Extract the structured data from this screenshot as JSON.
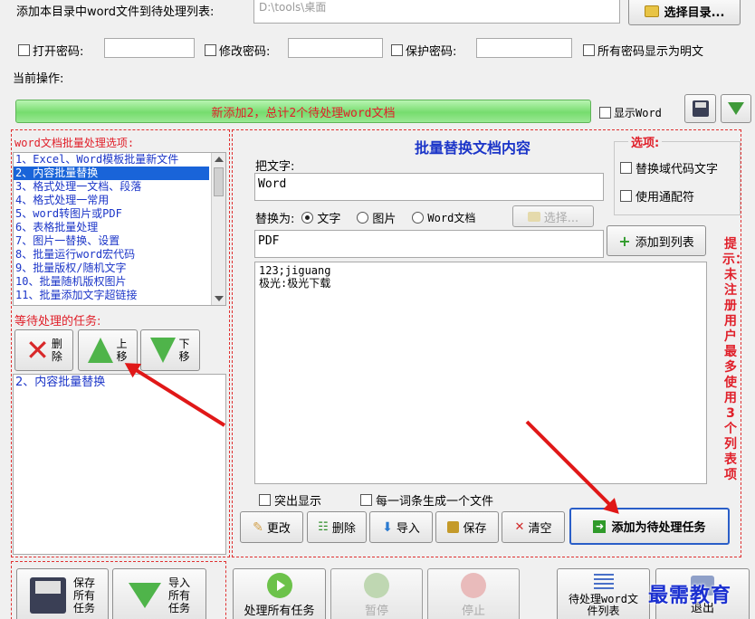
{
  "top": {
    "add_dir_label": "添加本目录中word文件到待处理列表:",
    "dir_path": "D:\\tools\\桌面",
    "choose_dir_label": "选择目录..."
  },
  "passwords": {
    "open_label": "打开密码:",
    "modify_label": "修改密码:",
    "protect_label": "保护密码:",
    "show_plain_label": "所有密码显示为明文"
  },
  "current_op_label": "当前操作:",
  "progress": {
    "message": "新添加2，总计2个待处理word文档",
    "show_word_label": "显示Word"
  },
  "options_panel": {
    "title": "word文档批量处理选项:",
    "items": [
      "1、Excel、Word模板批量新文件",
      "2、内容批量替换",
      "3、格式处理一文档、段落",
      "4、格式处理一常用",
      "5、word转图片或PDF",
      "6、表格批量处理",
      "7、图片一替换、设置",
      "8、批量运行word宏代码",
      "9、批量版权/随机文字",
      "10、批量随机版权图片",
      "11、批量添加文字超链接"
    ],
    "selected_index": 1
  },
  "tasks_panel": {
    "title": "等待处理的任务:",
    "delete_label": "删\n除",
    "up_label": "上\n移",
    "down_label": "下\n移",
    "items": [
      "2、内容批量替换"
    ]
  },
  "replace_panel": {
    "title": "批量替换文档内容",
    "find_label": "把文字:",
    "find_value": "Word",
    "replace_label": "替换为:",
    "radio_text": "文字",
    "radio_image": "图片",
    "radio_worddoc": "Word文档",
    "select_label": "选择...",
    "replace_value": "PDF",
    "add_to_list_label": "添加到列表",
    "list_text": "123;jiguang\n极光:极光下载",
    "highlight_label": "突出显示",
    "per_entry_file_label": "每一词条生成一个文件",
    "edit_label": "更改",
    "delete_label": "删除",
    "import_label": "导入",
    "save_label": "保存",
    "clear_label": "清空",
    "add_task_label": "添加为待处理任务"
  },
  "options_box": {
    "title": "选项:",
    "replace_field_code_label": "替换域代码文字",
    "use_wildcard_label": "使用通配符"
  },
  "vertical_tip": "提示：未注册用户最多使用3个列表项",
  "bottom": {
    "save_all_label": "保存\n所有\n任务",
    "import_all_label": "导入\n所有\n任务",
    "process_all_label": "处理所有任务",
    "pause_label": "暂停",
    "stop_label": "停止",
    "pending_list_label": "待处理word文\n件列表",
    "exit_label": "退出"
  },
  "watermark": "最需教育",
  "colors": {
    "accent_red": "#e0202a",
    "list_blue": "#1b35c8",
    "selection": "#1964d9",
    "progress_green": "#7ee07a"
  }
}
